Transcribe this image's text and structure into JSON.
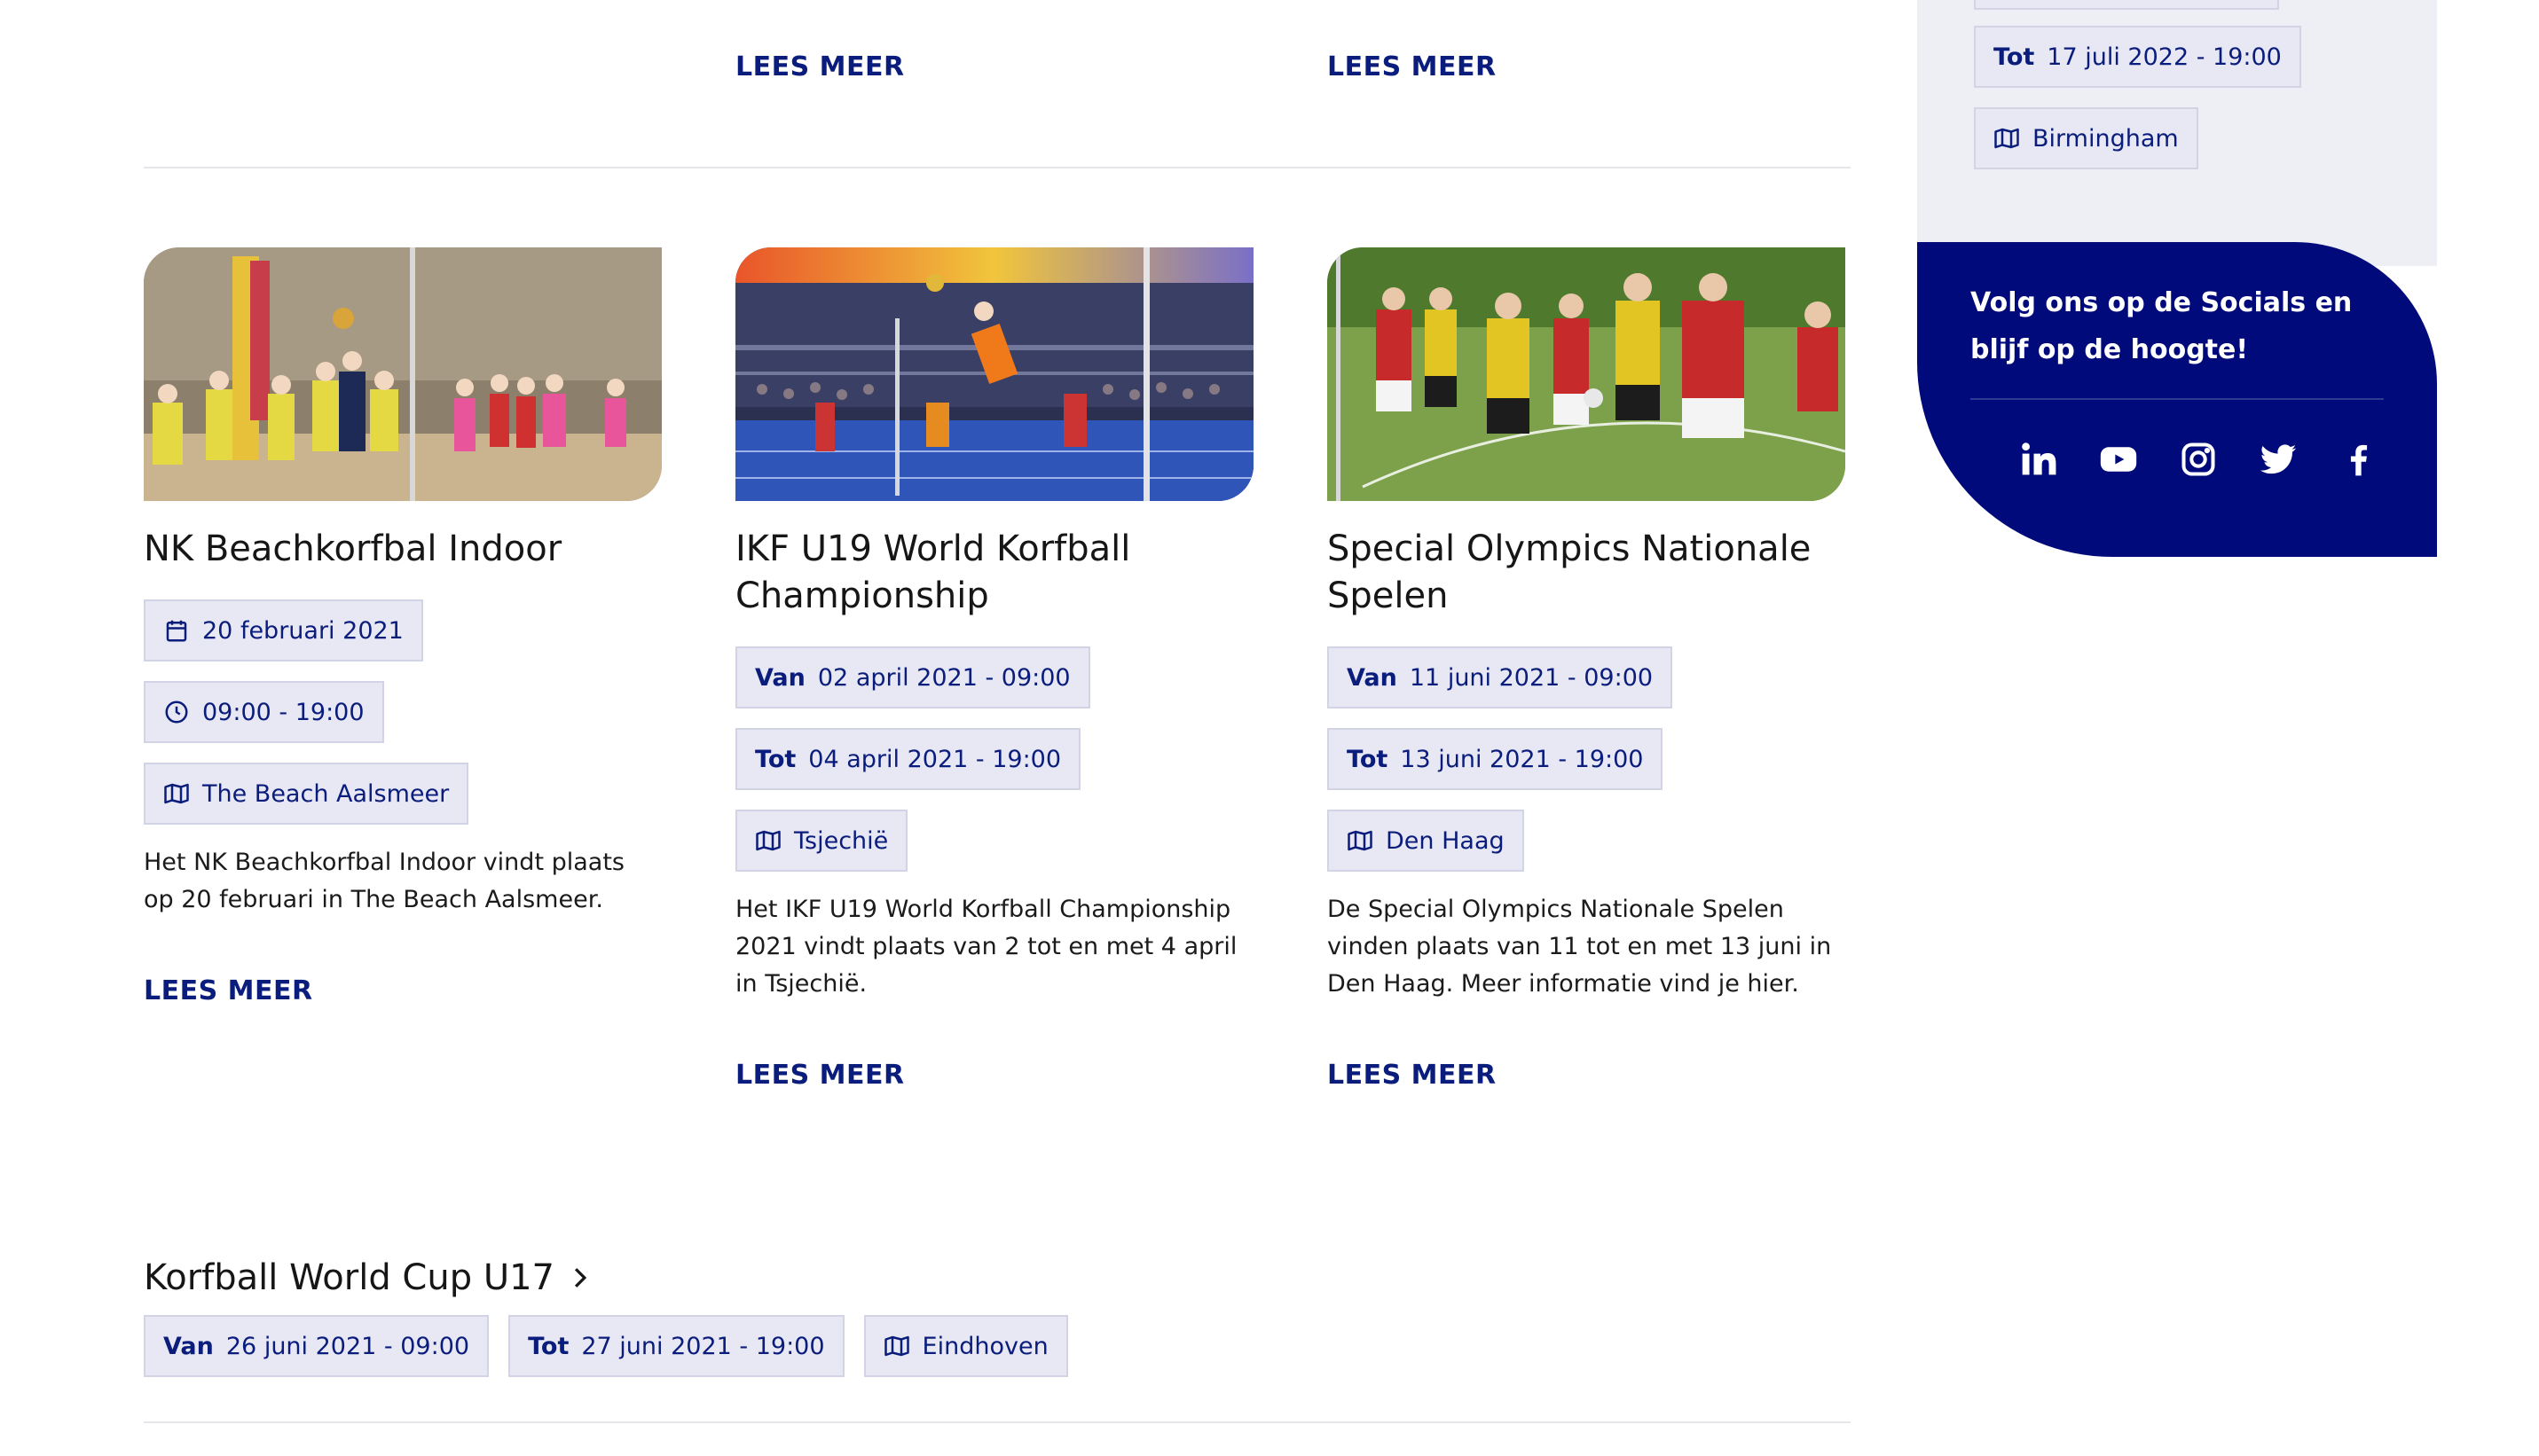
{
  "top_row": {
    "read_more_1": "LEES MEER",
    "read_more_2": "LEES MEER"
  },
  "sidebar": {
    "prev_event": {
      "to_prefix": "Tot",
      "to_value": "17 juli 2022 - 19:00",
      "location": "Birmingham"
    },
    "socials": {
      "message": "Volg ons op de Socials en blijf op de hoogte!",
      "icons": [
        "linkedin-icon",
        "youtube-icon",
        "instagram-icon",
        "twitter-icon",
        "facebook-icon"
      ]
    }
  },
  "cards": [
    {
      "title": "NK Beachkorfbal Indoor",
      "date": "20 februari 2021",
      "time": "09:00 - 19:00",
      "location": "The Beach Aalsmeer",
      "description": "Het NK Beachkorfbal Indoor vindt plaats op 20 februari in The Beach Aalsmeer.",
      "read_more": "LEES MEER"
    },
    {
      "title": "IKF U19 World Korfball Championship",
      "from_prefix": "Van",
      "from_value": "02 april 2021 - 09:00",
      "to_prefix": "Tot",
      "to_value": "04 april 2021 - 19:00",
      "location": "Tsjechië",
      "description": "Het IKF U19 World Korfball Championship 2021 vindt plaats van 2 tot en met 4 april in Tsjechië.",
      "read_more": "LEES MEER"
    },
    {
      "title": "Special Olympics Nationale Spelen",
      "from_prefix": "Van",
      "from_value": "11 juni 2021 - 09:00",
      "to_prefix": "Tot",
      "to_value": "13 juni 2021 - 19:00",
      "location": "Den Haag",
      "description": "De Special Olympics Nationale Spelen vinden plaats van 11 tot en met 13 juni in Den Haag. Meer informatie vind je hier.",
      "read_more": "LEES MEER"
    }
  ],
  "world_cup": {
    "title": "Korfball World Cup U17",
    "from_prefix": "Van",
    "from_value": "26 juni 2021 - 09:00",
    "to_prefix": "Tot",
    "to_value": "27 juni 2021 - 19:00",
    "location": "Eindhoven"
  },
  "colors": {
    "accent": "#0b1d7c",
    "chip_bg": "#e7e8f3",
    "social_bg": "#010a7a",
    "sidebar_bg": "#eeeef5"
  }
}
